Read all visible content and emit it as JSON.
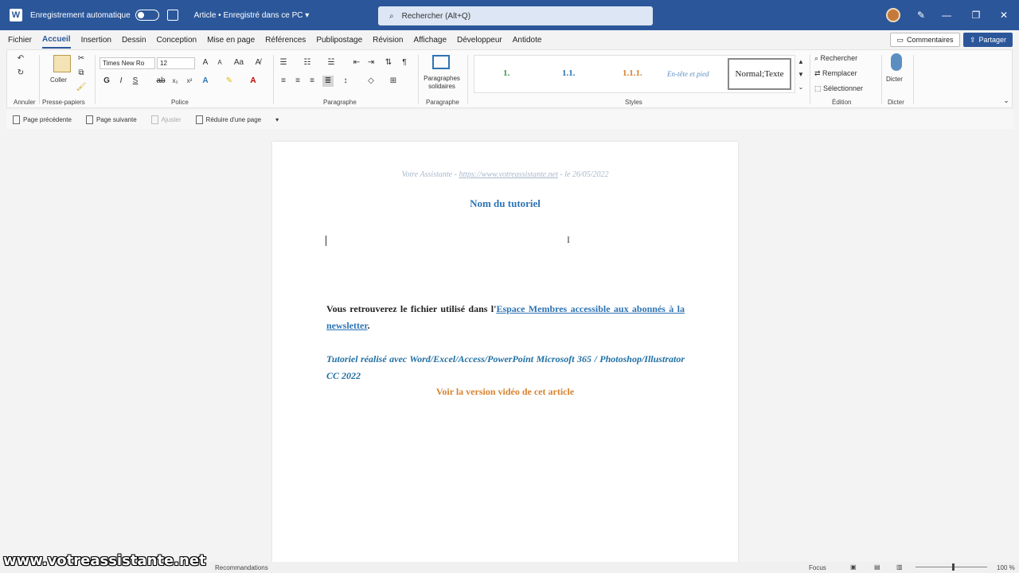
{
  "titlebar": {
    "app_icon": "W",
    "autosave_label": "Enregistrement automatique",
    "doc_name": "Article • Enregistré dans ce PC ▾",
    "search_placeholder": "Rechercher (Alt+Q)"
  },
  "menu": {
    "tabs": [
      "Fichier",
      "Accueil",
      "Insertion",
      "Dessin",
      "Conception",
      "Mise en page",
      "Références",
      "Publipostage",
      "Révision",
      "Affichage",
      "Développeur",
      "Antidote"
    ],
    "active": "Accueil",
    "comments_label": "Commentaires",
    "share_label": "Partager"
  },
  "ribbon": {
    "undo_label": "Annuler",
    "paste_label": "Coller",
    "clipboard_label": "Presse-papiers",
    "font_name": "Times New Ro",
    "font_size": "12",
    "font_group": "Police",
    "paragraph_group": "Paragraphe",
    "solidary_label": "Paragraphes solidaires",
    "solidary_group": "Paragraphe",
    "styles": [
      "1.",
      "1.1.",
      "1.1.1.",
      "En-tête et pied",
      "Normal;Texte"
    ],
    "styles_group": "Styles",
    "find_label": "Rechercher",
    "replace_label": "Remplacer",
    "select_label": "Sélectionner",
    "edit_group": "Édition",
    "dictate_label": "Dicter",
    "voice_group": "Dicter"
  },
  "navbar": {
    "prev": "Page précédente",
    "next": "Page suivante",
    "adjust": "Ajuster",
    "shrink": "Réduire d'une page"
  },
  "document": {
    "header_text": "Votre Assistante - ",
    "header_link": "https://www.votreassistante.net",
    "header_date": " - le 26/05/2022",
    "title": "Nom du tutoriel",
    "para1_text": "Vous retrouverez le fichier utilisé dans l'",
    "para1_link": "Espace Membres accessible aux abonnés à la newsletter",
    "para1_end": ".",
    "para2": "Tutoriel réalisé avec Word/Excel/Access/PowerPoint Microsoft 365 / Photoshop/Illustrator CC 2022",
    "para3": "Voir la version vidéo de cet article"
  },
  "statusbar": {
    "left": "Recommandations",
    "focus": "Focus",
    "zoom": "100 %"
  },
  "watermark": "www.votreassistante.net",
  "colors": {
    "title_bar": "#2b579a",
    "heading": "#2e74b5",
    "accent_orange": "#d7822f"
  }
}
